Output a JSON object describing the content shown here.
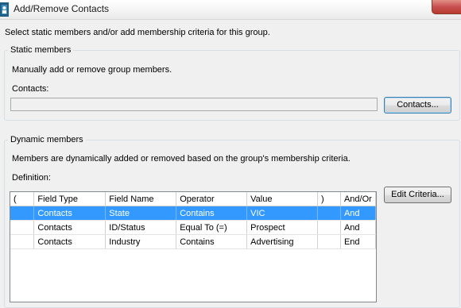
{
  "window": {
    "title": "Add/Remove Contacts"
  },
  "intro": "Select static members and/or add membership criteria for this group.",
  "static_members": {
    "legend": "Static members",
    "description": "Manually add or remove group members.",
    "contacts_label": "Contacts:",
    "contacts_value": "",
    "contacts_button": "Contacts..."
  },
  "dynamic_members": {
    "legend": "Dynamic members",
    "description": "Members are dynamically added or removed based on the group's membership criteria.",
    "definition_label": "Definition:",
    "edit_button": "Edit Criteria...",
    "columns": [
      "(",
      "Field Type",
      "Field Name",
      "Operator",
      "Value",
      ")",
      "And/Or"
    ],
    "rows": [
      {
        "open": "",
        "field_type": "Contacts",
        "field_name": "State",
        "operator": "Contains",
        "value": "VIC",
        "close": "",
        "and_or": "And",
        "selected": true
      },
      {
        "open": "",
        "field_type": "Contacts",
        "field_name": "ID/Status",
        "operator": "Equal To (=)",
        "value": "Prospect",
        "close": "",
        "and_or": "And",
        "selected": false
      },
      {
        "open": "",
        "field_type": "Contacts",
        "field_name": "Industry",
        "operator": "Contains",
        "value": "Advertising",
        "close": "",
        "and_or": "End",
        "selected": false
      }
    ]
  },
  "colors": {
    "selection": "#3399ff",
    "close_button": "#c75050"
  },
  "icons": {
    "app": "contacts-app-icon",
    "close": "close-icon"
  }
}
